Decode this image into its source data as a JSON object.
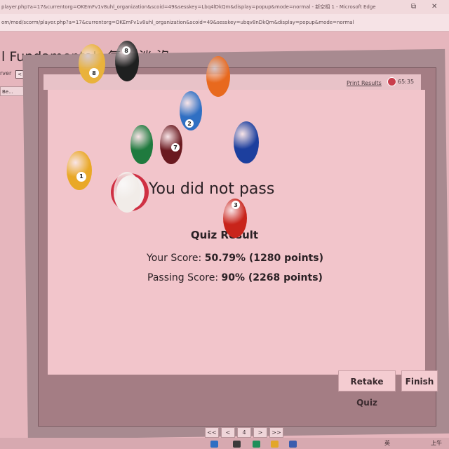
{
  "browser": {
    "title_text": "player.php?a=17&currentorg=OKEmFv1v8uhl_organization&scoid=49&sesskey=Lbq4lDkQm&display=popup&mode=normal - 新空相 1 - Microsoft Edge",
    "address_text": "om/mod/scorm/player.php?a=17&currentorg=OKEmFv1v8uhl_organization&scoid=49&sesskey=ubqv8nDkQm&display=popup&mode=normal"
  },
  "course": {
    "title": "l Fundamentals 氧 氵淡 沒",
    "server_label": "rver",
    "side_button": "Be..."
  },
  "header": {
    "print_results": "Print Results",
    "timer": "65:35"
  },
  "result": {
    "heading": "You did not pass",
    "quiz_result": "Quiz Result",
    "your_score_label": "Your Score:",
    "your_score_value": "50.79% (1280 points)",
    "passing_score_label": "Passing Score:",
    "passing_score_value": "90% (2268 points)"
  },
  "actions": {
    "retake": "Retake Quiz",
    "finish": "Finish"
  },
  "pager": {
    "first": "<<",
    "prev": "<",
    "page": "4",
    "next": ">",
    "last": ">>"
  },
  "taskbar": {
    "tray_text": "英",
    "clock": "上午"
  },
  "balls": [
    {
      "name": "yellow-8-ball",
      "color": "#e9b23c",
      "label": "8"
    },
    {
      "name": "black-8-ball",
      "color": "#1f2020",
      "label": "8"
    },
    {
      "name": "orange-ball",
      "color": "#e8691e",
      "label": ""
    },
    {
      "name": "blue-ball",
      "color": "#2f6fc3",
      "label": "2"
    },
    {
      "name": "green-ball",
      "color": "#1f7a3e",
      "label": ""
    },
    {
      "name": "maroon-ball",
      "color": "#6a1a20",
      "label": "7"
    },
    {
      "name": "navy-ball",
      "color": "#1c3f9e",
      "label": ""
    },
    {
      "name": "yellow-1-ball",
      "color": "#e9a826",
      "label": "1"
    },
    {
      "name": "white-cue-ball",
      "color": "#f1ece8",
      "label": ""
    },
    {
      "name": "red-ball",
      "color": "#c8241b",
      "label": "3"
    }
  ],
  "colors": {
    "fail_red": "#cf3043",
    "panel_bg": "#f2c5cb",
    "frame_bg": "#a47d84"
  }
}
